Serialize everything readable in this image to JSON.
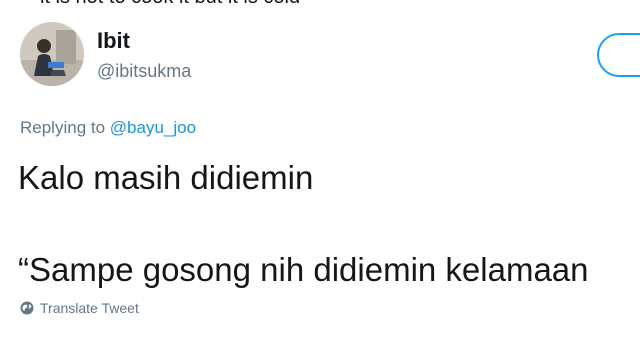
{
  "top_cut_text": "it is hot to cook it but it is cold",
  "user": {
    "name": "Ibit",
    "handle": "@ibitsukma"
  },
  "reply": {
    "prefix": "Replying to",
    "mention": "@bayu_joo"
  },
  "tweet": {
    "line1": "Kalo masih didiemin",
    "line2": "“Sampe gosong nih didiemin kelamaan"
  },
  "translate": {
    "label": "Translate Tweet",
    "icon": "globe-icon"
  },
  "colors": {
    "accent": "#1da1f2",
    "mention": "#1b95e0",
    "secondary_text": "#657786",
    "primary_text": "#14171a"
  }
}
